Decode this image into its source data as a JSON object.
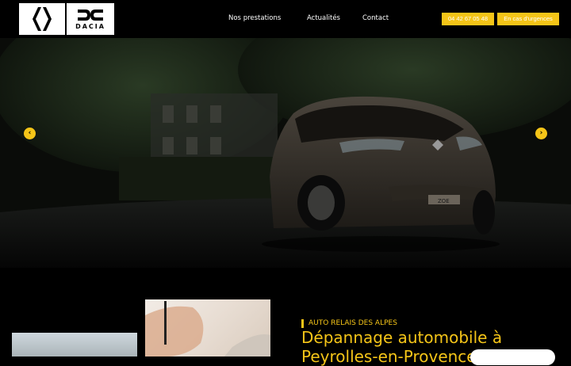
{
  "header": {
    "brand_renault": "Renault",
    "brand_dacia": "DACIA",
    "nav": [
      "Nos prestations",
      "Actualités",
      "Contact"
    ],
    "phone_button": "04 42 67 05 48",
    "urgent_button": "En cas d'urgences"
  },
  "hero": {
    "car_badge": "ZOE",
    "prev_arrow": "‹",
    "next_arrow": "›"
  },
  "intro": {
    "kicker": "AUTO RELAIS DES ALPES",
    "title": "Dépannage automobile à Peyrolles-en-Provence"
  },
  "colors": {
    "accent": "#f5c518",
    "background": "#000000"
  }
}
